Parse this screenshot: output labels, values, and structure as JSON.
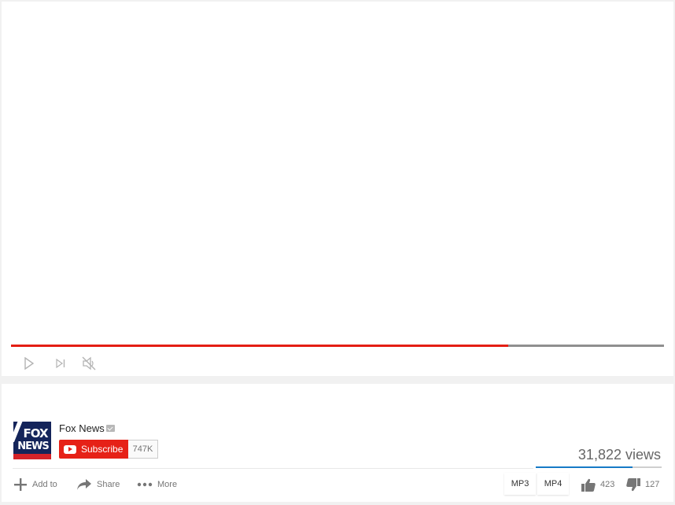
{
  "player": {
    "progress_fraction": 0.762,
    "colors": {
      "played": "#e41e13",
      "remaining": "#8f8f8f"
    },
    "controls": [
      "play-icon",
      "next-icon",
      "mute-icon"
    ]
  },
  "channel": {
    "logo_text_top": "FOX",
    "logo_text_bottom": "NEWS",
    "name": "Fox News",
    "verified_icon": "verified-badge-icon",
    "subscribe_label": "Subscribe",
    "subscriber_count": "747K"
  },
  "stats": {
    "views": "31,822 views",
    "like_ratio": 0.769,
    "likes": "423",
    "dislikes": "127"
  },
  "actions": {
    "add_to": "Add to",
    "share": "Share",
    "more": "More"
  },
  "downloads": {
    "mp3": "MP3",
    "mp4": "MP4"
  },
  "colors": {
    "brand_red": "#e62117",
    "like_bar": "#167ac6"
  }
}
